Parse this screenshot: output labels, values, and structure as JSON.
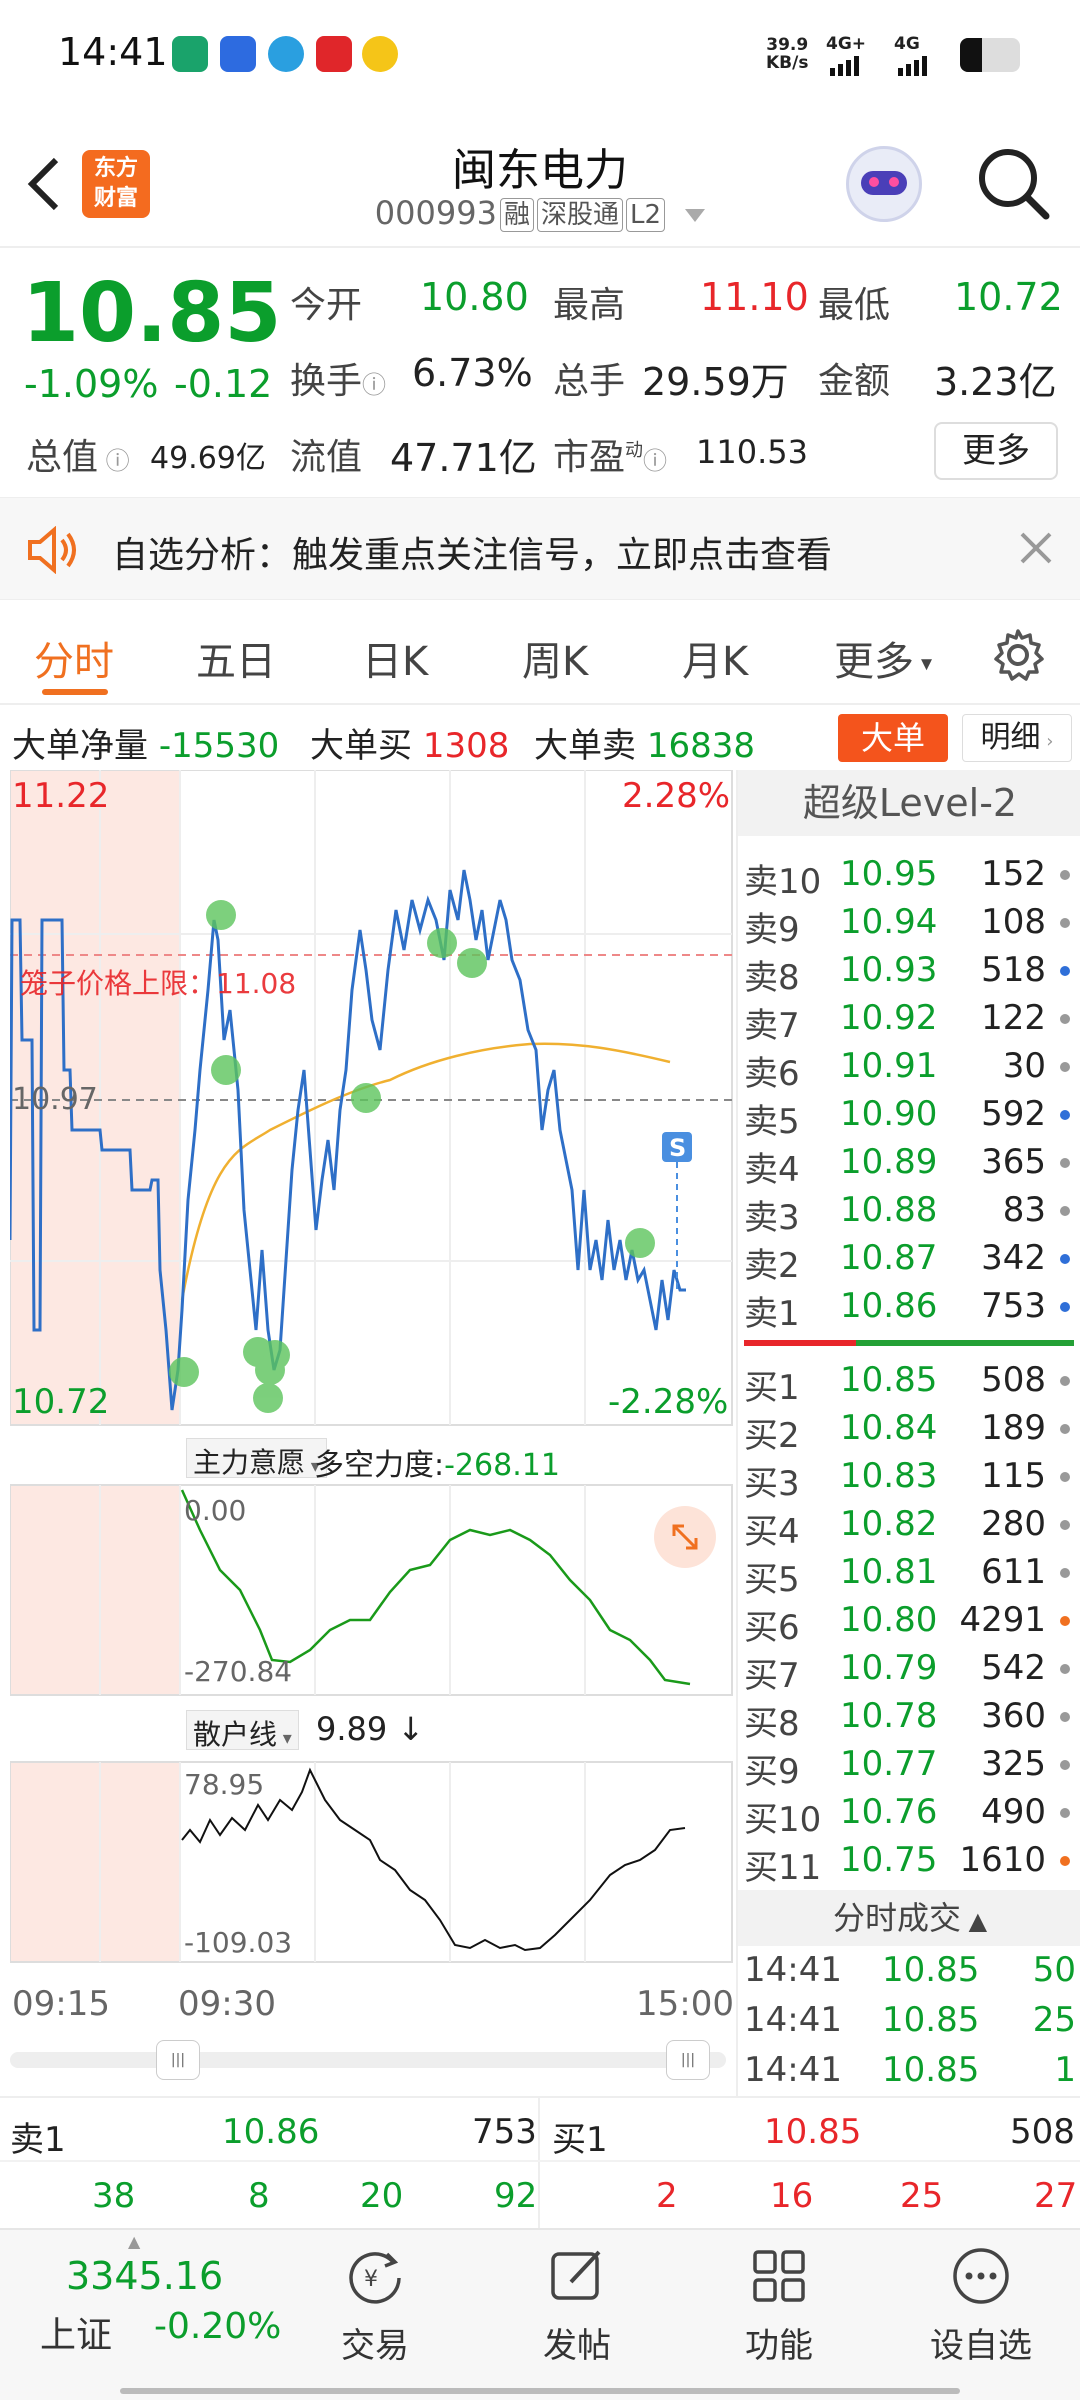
{
  "status_bar": {
    "time": "14:41",
    "net_speed": "39.9",
    "net_unit": "KB/s",
    "sim1": "4G+",
    "sim2": "4G"
  },
  "header": {
    "name": "闽东电力",
    "code": "000993",
    "tags": [
      "融",
      "深股通",
      "L2"
    ],
    "logo_line1": "东方",
    "logo_line2": "财富"
  },
  "quote": {
    "price": "10.85",
    "pct": "-1.09%",
    "chg": "-0.12",
    "open_label": "今开",
    "open": "10.80",
    "high_label": "最高",
    "high": "11.10",
    "low_label": "最低",
    "low": "10.72",
    "turnover_label": "换手",
    "turnover": "6.73%",
    "volume_label": "总手",
    "volume": "29.59万",
    "amount_label": "金额",
    "amount": "3.23亿",
    "mktcap_label": "总值",
    "mktcap": "49.69亿",
    "float_label": "流值",
    "float": "47.71亿",
    "pe_label": "市盈",
    "pe_sup": "动",
    "pe": "110.53",
    "more": "更多"
  },
  "notice": {
    "text": "自选分析：触发重点关注信号，立即点击查看"
  },
  "tabs": [
    "分时",
    "五日",
    "日K",
    "周K",
    "月K",
    "更多"
  ],
  "big_order": {
    "net_label": "大单净量",
    "net": "-15530",
    "buy_label": "大单买",
    "buy": "1308",
    "sell_label": "大单卖",
    "sell": "16838",
    "btn_big": "大单",
    "btn_detail": "明细"
  },
  "chart": {
    "max_price": "11.22",
    "max_pct": "2.28%",
    "min_price": "10.72",
    "min_pct": "-2.28%",
    "cage_label": "笼子价格上限：11.08",
    "prev_close": "10.97",
    "s_marker": "S",
    "ind1_label": "主力意愿",
    "ind1_name": "多空力度:",
    "ind1_value": "-268.11",
    "ind1_top": "0.00",
    "ind1_bottom": "-270.84",
    "ind2_label": "散户线",
    "ind2_value": "9.89 ↓",
    "ind2_top": "78.95",
    "ind2_bottom": "-109.03",
    "time_start": "09:15",
    "time_open": "09:30",
    "time_end": "15:00"
  },
  "level2": {
    "title": "超级Level-2",
    "sells": [
      {
        "label": "卖10",
        "price": "10.95",
        "vol": "152",
        "dot": "#999"
      },
      {
        "label": "卖9",
        "price": "10.94",
        "vol": "108",
        "dot": "#999"
      },
      {
        "label": "卖8",
        "price": "10.93",
        "vol": "518",
        "dot": "#2f6fd8"
      },
      {
        "label": "卖7",
        "price": "10.92",
        "vol": "122",
        "dot": "#999"
      },
      {
        "label": "卖6",
        "price": "10.91",
        "vol": "30",
        "dot": "#999"
      },
      {
        "label": "卖5",
        "price": "10.90",
        "vol": "592",
        "dot": "#2f6fd8"
      },
      {
        "label": "卖4",
        "price": "10.89",
        "vol": "365",
        "dot": "#999"
      },
      {
        "label": "卖3",
        "price": "10.88",
        "vol": "83",
        "dot": "#999"
      },
      {
        "label": "卖2",
        "price": "10.87",
        "vol": "342",
        "dot": "#2f6fd8"
      },
      {
        "label": "卖1",
        "price": "10.86",
        "vol": "753",
        "dot": "#2f6fd8"
      }
    ],
    "buys": [
      {
        "label": "买1",
        "price": "10.85",
        "vol": "508",
        "dot": "#999"
      },
      {
        "label": "买2",
        "price": "10.84",
        "vol": "189",
        "dot": "#999"
      },
      {
        "label": "买3",
        "price": "10.83",
        "vol": "115",
        "dot": "#999"
      },
      {
        "label": "买4",
        "price": "10.82",
        "vol": "280",
        "dot": "#999"
      },
      {
        "label": "买5",
        "price": "10.81",
        "vol": "611",
        "dot": "#999"
      },
      {
        "label": "买6",
        "price": "10.80",
        "vol": "4291",
        "dot": "#f07020"
      },
      {
        "label": "买7",
        "price": "10.79",
        "vol": "542",
        "dot": "#999"
      },
      {
        "label": "买8",
        "price": "10.78",
        "vol": "360",
        "dot": "#999"
      },
      {
        "label": "买9",
        "price": "10.77",
        "vol": "325",
        "dot": "#999"
      },
      {
        "label": "买10",
        "price": "10.76",
        "vol": "490",
        "dot": "#999"
      },
      {
        "label": "买11",
        "price": "10.75",
        "vol": "1610",
        "dot": "#f07020"
      }
    ],
    "ticks_title": "分时成交",
    "ticks": [
      {
        "time": "14:41",
        "price": "10.85",
        "vol": "50"
      },
      {
        "time": "14:41",
        "price": "10.85",
        "vol": "25"
      },
      {
        "time": "14:41",
        "price": "10.85",
        "vol": "1"
      }
    ]
  },
  "bottom_quote": {
    "sell_label": "卖1",
    "sell_price": "10.86",
    "sell_vol": "753",
    "buy_label": "买1",
    "buy_price": "10.85",
    "buy_vol": "508",
    "sell_queue": [
      "38",
      "8",
      "20",
      "92"
    ],
    "buy_queue": [
      "2",
      "16",
      "25",
      "27"
    ]
  },
  "bottom_nav": {
    "index_value": "3345.16",
    "index_name": "上证",
    "index_pct": "-0.20%",
    "items": [
      "交易",
      "发帖",
      "功能",
      "设自选"
    ]
  }
}
